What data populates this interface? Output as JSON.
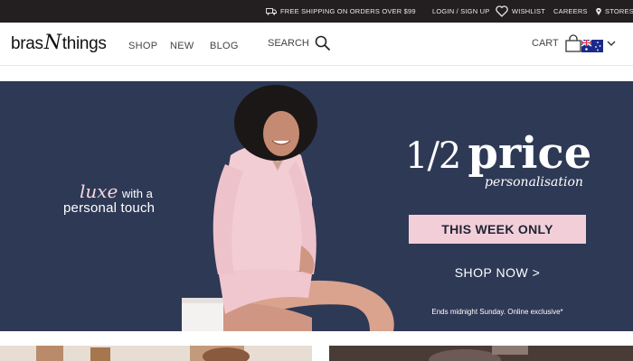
{
  "topbar": {
    "shipping": "FREE SHIPPING ON ORDERS OVER $99",
    "login": "LOGIN / SIGN UP",
    "wishlist": "WISHLIST",
    "careers": "CAREERS",
    "stores": "STORES"
  },
  "header": {
    "logo_left": "bras",
    "logo_n": "N",
    "logo_right": "things",
    "nav": [
      "SHOP",
      "NEW",
      "BLOG"
    ],
    "search_label": "SEARCH",
    "cart_label": "CART"
  },
  "hero": {
    "tagline_luxe": "luxe",
    "tagline_with": "with a",
    "tagline_line2": "personal touch",
    "price_fraction": "1/2",
    "price_word": "price",
    "price_sub": "personalisation",
    "week_label": "THIS WEEK ONLY",
    "shop_now": "SHOP NOW >",
    "ends": "Ends midnight Sunday. Online exclusive*"
  },
  "colors": {
    "topbar": "#231f20",
    "hero_bg": "#2e3955",
    "accent_pink": "#f2cfd8"
  },
  "icons": [
    "truck-icon",
    "heart-icon",
    "map-pin-icon",
    "search-icon",
    "bag-icon",
    "au-flag-icon",
    "chevron-down-icon"
  ]
}
